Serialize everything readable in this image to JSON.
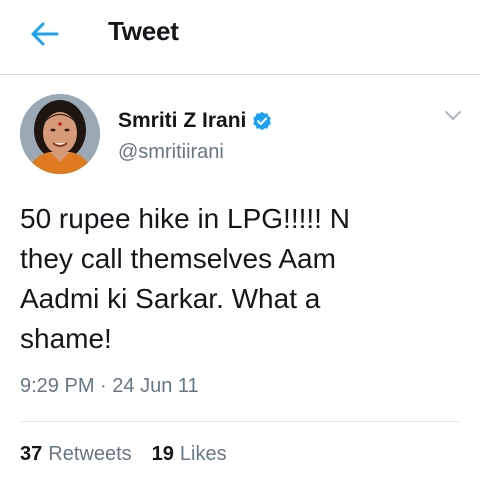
{
  "header": {
    "back_icon": "arrow-left-icon",
    "title": "Tweet"
  },
  "tweet": {
    "author": {
      "name": "Smriti Z Irani",
      "handle": "@smritiirani",
      "verified": true,
      "verified_icon": "verified-badge-icon"
    },
    "menu_icon": "chevron-down-icon",
    "text": "50 rupee hike in LPG!!!!! N\nthey call themselves Aam\nAadmi ki Sarkar. What a\nshame!",
    "time": "9:29 PM",
    "separator": "·",
    "date": "24 Jun 11",
    "stats": {
      "retweets_count": "37",
      "retweets_label": "Retweets",
      "likes_count": "19",
      "likes_label": "Likes"
    }
  },
  "colors": {
    "accent": "#1da1f2",
    "secondary_text": "#657786",
    "primary_text": "#14171a",
    "divider": "#e1e8ed"
  }
}
